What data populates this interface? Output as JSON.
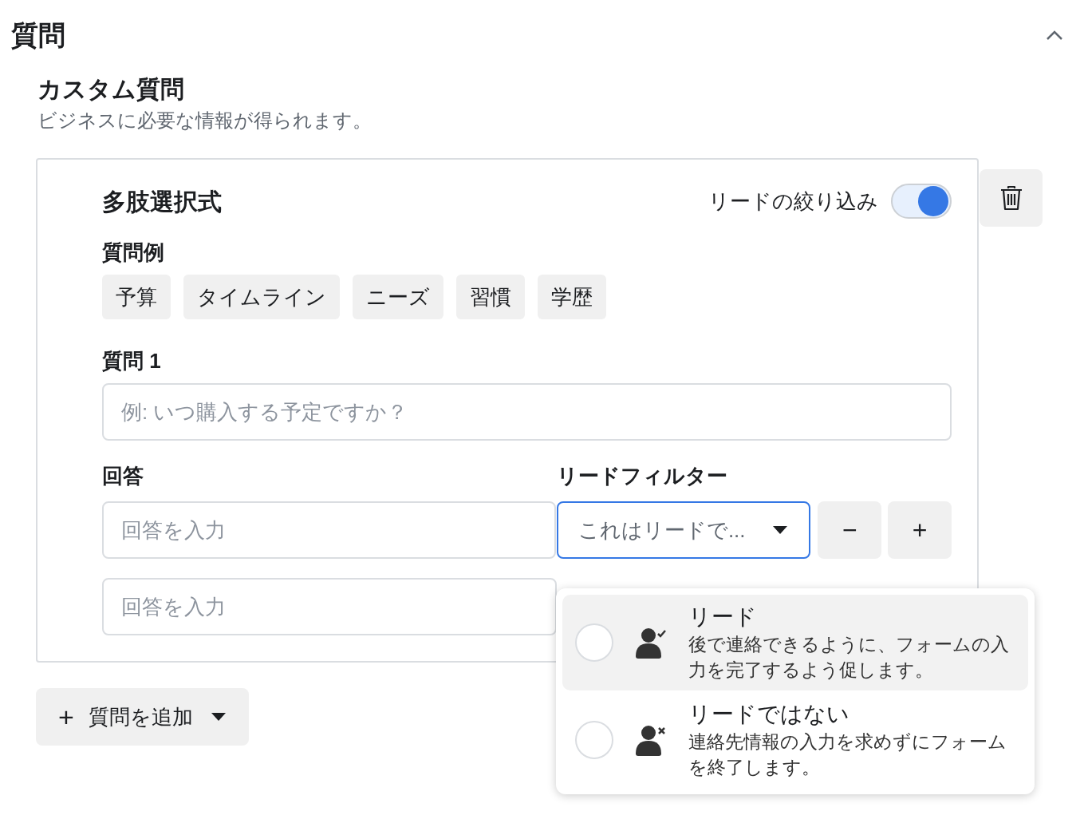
{
  "section": {
    "title": "質問",
    "expanded": true
  },
  "custom": {
    "title": "カスタム質問",
    "description": "ビジネスに必要な情報が得られます。"
  },
  "card": {
    "title": "多肢選択式",
    "lead_filter_toggle": {
      "label": "リードの絞り込み",
      "on": true
    },
    "examples_label": "質問例",
    "examples": [
      "予算",
      "タイムライン",
      "ニーズ",
      "習慣",
      "学歴"
    ],
    "question": {
      "label": "質問 1",
      "placeholder": "例: いつ購入する予定ですか？"
    },
    "answers_label": "回答",
    "filter_label": "リードフィルター",
    "answers": [
      {
        "placeholder": "回答を入力",
        "filter": {
          "value": "これはリードで...",
          "expanded": true
        },
        "remove": "−",
        "add": "+"
      },
      {
        "placeholder": "回答を入力"
      }
    ]
  },
  "filter_menu": [
    {
      "kind": "lead",
      "title": "リード",
      "description": "後で連絡できるように、フォームの入力を完了するよう促します。",
      "selected": false,
      "highlighted": true
    },
    {
      "kind": "not_lead",
      "title": "リードではない",
      "description": "連絡先情報の入力を求めずにフォームを終了します。",
      "selected": false,
      "highlighted": false
    }
  ],
  "add_question": {
    "icon": "+",
    "label": "質問を追加"
  }
}
